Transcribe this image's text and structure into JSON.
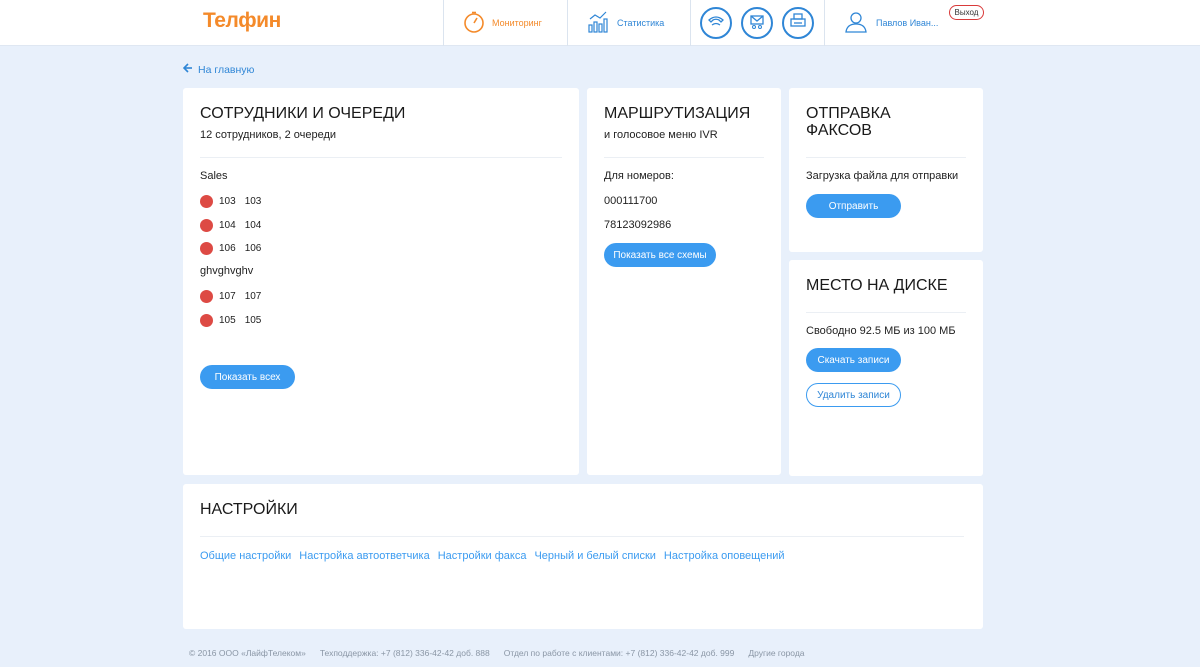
{
  "header": {
    "logo": "Телфин",
    "monitoring": "Мониторинг",
    "statistics": "Статистика",
    "user_name": "Павлов Иван...",
    "logout": "Выход"
  },
  "back_link": "На главную",
  "employees": {
    "title": "СОТРУДНИКИ И ОЧЕРЕДИ",
    "subtitle": "12 сотрудников, 2 очереди",
    "queues": [
      {
        "name": "Sales",
        "members": [
          {
            "ext": "103",
            "name": "103"
          },
          {
            "ext": "104",
            "name": "104"
          },
          {
            "ext": "106",
            "name": "106"
          }
        ]
      },
      {
        "name": "ghvghvghv",
        "members": [
          {
            "ext": "107",
            "name": "107"
          },
          {
            "ext": "105",
            "name": "105"
          }
        ]
      }
    ],
    "show_all": "Показать всех"
  },
  "routing": {
    "title": "МАРШРУТИЗАЦИЯ",
    "subtitle": "и голосовое меню IVR",
    "numbers_label": "Для номеров:",
    "numbers": [
      "000111700",
      "78123092986"
    ],
    "show_all": "Показать все схемы"
  },
  "fax": {
    "title_line1": "ОТПРАВКА",
    "title_line2": "ФАКСОВ",
    "upload_label": "Загрузка файла для отправки",
    "send": "Отправить"
  },
  "disk": {
    "title": "МЕСТО НА ДИСКЕ",
    "free": "Свободно 92.5 МБ из 100 МБ",
    "download": "Скачать записи",
    "delete": "Удалить записи"
  },
  "settings": {
    "title": "НАСТРОЙКИ",
    "links": [
      "Общие настройки",
      "Настройка автоответчика",
      "Настройки факса",
      "Черный и белый списки",
      "Настройка оповещений"
    ]
  },
  "footer": {
    "copyright": "© 2016 ООО «ЛайфТелеком»",
    "support": "Техподдержка: +7 (812) 336-42-42 доб. 888",
    "clients": "Отдел по работе с клиентами: +7 (812) 336-42-42 доб. 999",
    "cities": "Другие города"
  },
  "colors": {
    "accent": "#3b9bf0",
    "brand": "#f48a2a",
    "status_offline": "#dd4a44",
    "background": "#e8f0fb"
  }
}
